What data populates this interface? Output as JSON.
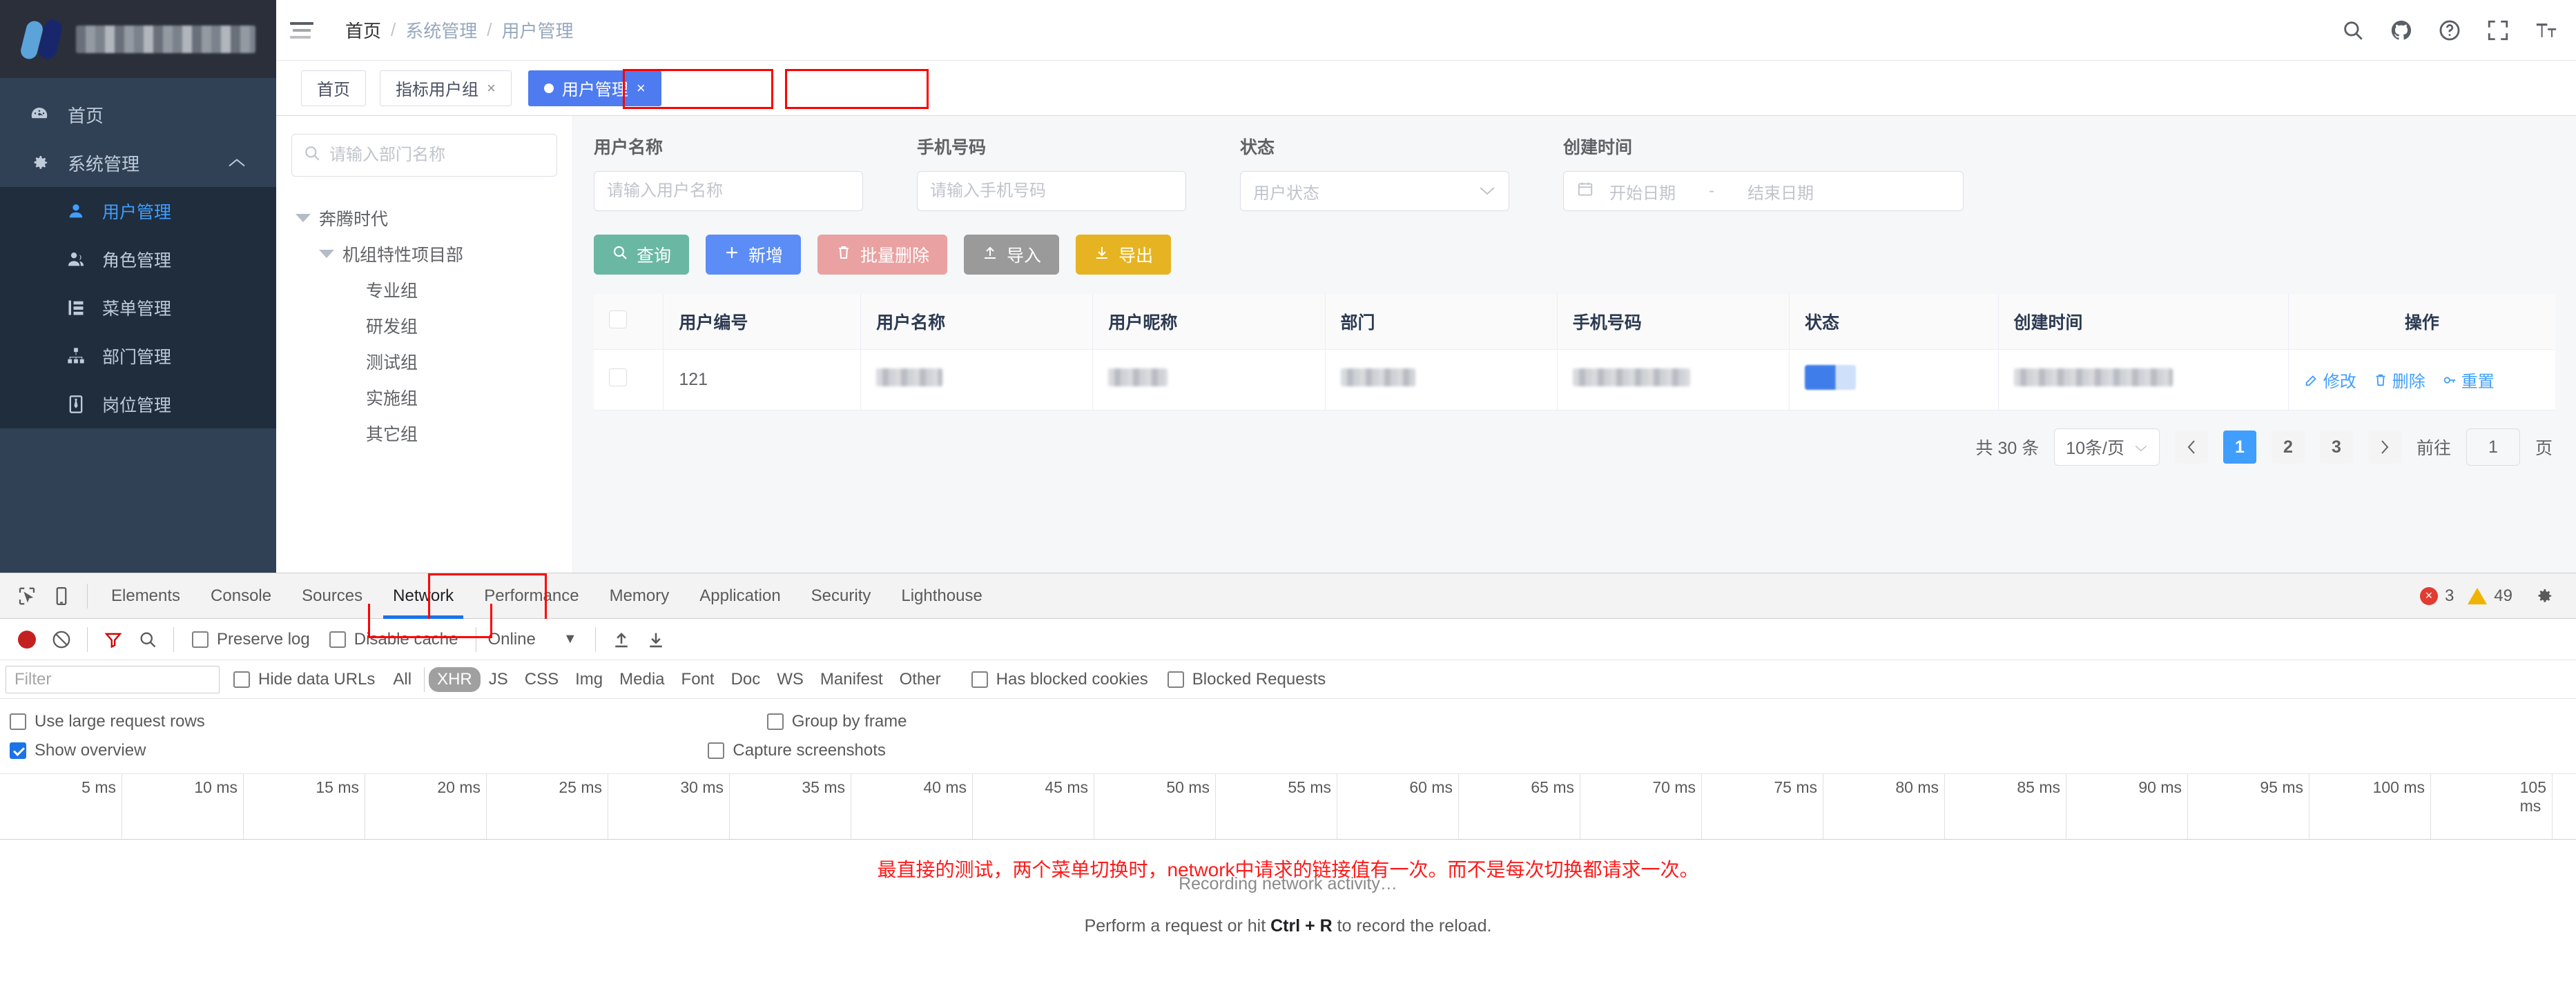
{
  "sidebar": {
    "logo_alt": "blurred-company-logo",
    "items": [
      {
        "label": "首页",
        "icon": "dashboard-icon"
      },
      {
        "label": "系统管理",
        "icon": "gear-icon",
        "expanded": true
      }
    ],
    "submenu": [
      {
        "label": "用户管理",
        "icon": "user-icon",
        "active": true
      },
      {
        "label": "角色管理",
        "icon": "users-icon",
        "active": false
      },
      {
        "label": "菜单管理",
        "icon": "menu-tree-icon",
        "active": false
      },
      {
        "label": "部门管理",
        "icon": "org-chart-icon",
        "active": false
      },
      {
        "label": "岗位管理",
        "icon": "tie-icon",
        "active": false
      }
    ]
  },
  "header": {
    "breadcrumb": [
      "首页",
      "系统管理",
      "用户管理"
    ],
    "icons": [
      "search-icon",
      "github-icon",
      "help-icon",
      "fullscreen-icon",
      "font-size-icon"
    ]
  },
  "tabs": [
    {
      "label": "首页",
      "closable": false,
      "state": "normal"
    },
    {
      "label": "指标用户组",
      "closable": true,
      "state": "normal",
      "highlight": true
    },
    {
      "label": "用户管理",
      "closable": true,
      "state": "active-blue",
      "highlight": true
    }
  ],
  "tree": {
    "search_placeholder": "请输入部门名称",
    "search_value": "",
    "search_icon": "search-icon",
    "nodes": [
      {
        "label": "奔腾时代",
        "depth": 0,
        "expandable": true
      },
      {
        "label": "机组特性项目部",
        "depth": 1,
        "expandable": true
      },
      {
        "label": "专业组",
        "depth": 2,
        "expandable": false
      },
      {
        "label": "研发组",
        "depth": 2,
        "expandable": false
      },
      {
        "label": "测试组",
        "depth": 2,
        "expandable": false
      },
      {
        "label": "实施组",
        "depth": 2,
        "expandable": false
      },
      {
        "label": "其它组",
        "depth": 2,
        "expandable": false
      }
    ]
  },
  "search_form": {
    "fields": [
      {
        "label": "用户名称",
        "placeholder": "请输入用户名称",
        "value": "",
        "type": "text"
      },
      {
        "label": "手机号码",
        "placeholder": "请输入手机号码",
        "value": "",
        "type": "text"
      },
      {
        "label": "状态",
        "placeholder": "用户状态",
        "value": "",
        "type": "select"
      },
      {
        "label": "创建时间",
        "placeholder_start": "开始日期",
        "placeholder_end": "结束日期",
        "separator": "-",
        "value": "",
        "type": "daterange",
        "icon": "calendar-icon"
      }
    ]
  },
  "buttons": [
    {
      "label": "查询",
      "icon": "search-icon",
      "color": "#6ab7a4",
      "key": "query"
    },
    {
      "label": "新增",
      "icon": "plus-icon",
      "color": "#5c8df6",
      "key": "add"
    },
    {
      "label": "批量删除",
      "icon": "trash-icon",
      "color": "#e9a1a1",
      "key": "del"
    },
    {
      "label": "导入",
      "icon": "upload-icon",
      "color": "#9a9a9a",
      "key": "import"
    },
    {
      "label": "导出",
      "icon": "download-icon",
      "color": "#e6b422",
      "key": "export"
    }
  ],
  "table": {
    "columns": [
      "",
      "用户编号",
      "用户名称",
      "用户昵称",
      "部门",
      "手机号码",
      "状态",
      "创建时间",
      "操作"
    ],
    "rows": [
      {
        "id": "121",
        "name": "[blurred]",
        "nickname": "[blurred]",
        "dept": "[blurred]",
        "phone": "[blurred]5543",
        "status": "[blurred-toggle]",
        "created": "[blurred] 04:07",
        "actions": [
          {
            "label": "修改",
            "icon": "edit-icon"
          },
          {
            "label": "删除",
            "icon": "trash-icon"
          },
          {
            "label": "重置",
            "icon": "key-icon"
          }
        ]
      }
    ]
  },
  "pagination": {
    "total_text": "共 30 条",
    "page_size_label": "10条/页",
    "prev_icon": "chevron-left-icon",
    "next_icon": "chevron-right-icon",
    "pages": [
      "1",
      "2",
      "3"
    ],
    "current_page": "1",
    "jump_label": "前往",
    "jump_value": "1",
    "jump_suffix": "页"
  },
  "devtools": {
    "panel_tabs": [
      "Elements",
      "Console",
      "Sources",
      "Network",
      "Performance",
      "Memory",
      "Application",
      "Security",
      "Lighthouse"
    ],
    "active_panel": "Network",
    "left_icons": [
      "inspect-icon",
      "device-toolbar-icon"
    ],
    "errors": "3",
    "warnings": "49",
    "settings_icon": "gear-icon",
    "toolbar": {
      "record_icon": "record-icon",
      "clear_icon": "clear-icon",
      "filter_icon": "filter-icon",
      "search_icon": "search-icon",
      "preserve_log": "Preserve log",
      "disable_cache": "Disable cache",
      "throttling": "Online",
      "throttling_caret": "▼",
      "import_icon": "import-har-icon",
      "export_icon": "export-har-icon"
    },
    "filterbar": {
      "filter_placeholder": "Filter",
      "filter_value": "",
      "hide_data_urls": "Hide data URLs",
      "types": [
        "All",
        "XHR",
        "JS",
        "CSS",
        "Img",
        "Media",
        "Font",
        "Doc",
        "WS",
        "Manifest",
        "Other"
      ],
      "active_type": "XHR",
      "has_blocked_cookies": "Has blocked cookies",
      "blocked_requests": "Blocked Requests"
    },
    "options": {
      "use_large_request_rows": "Use large request rows",
      "group_by_frame": "Group by frame",
      "show_overview": "Show overview",
      "show_overview_checked": true,
      "capture_screenshots": "Capture screenshots"
    },
    "overview_ticks": [
      "5 ms",
      "10 ms",
      "15 ms",
      "20 ms",
      "25 ms",
      "30 ms",
      "35 ms",
      "40 ms",
      "45 ms",
      "50 ms",
      "55 ms",
      "60 ms",
      "65 ms",
      "70 ms",
      "75 ms",
      "80 ms",
      "85 ms",
      "90 ms",
      "95 ms",
      "100 ms",
      "105 ms"
    ],
    "empty_state": {
      "recording": "Recording network activity…",
      "perform_prefix": "Perform a request or hit ",
      "perform_key": "Ctrl + R",
      "perform_suffix": " to record the reload."
    },
    "annotation": "最直接的测试，两个菜单切换时，network中请求的链接值有一次。而不是每次切换都请求一次。"
  }
}
